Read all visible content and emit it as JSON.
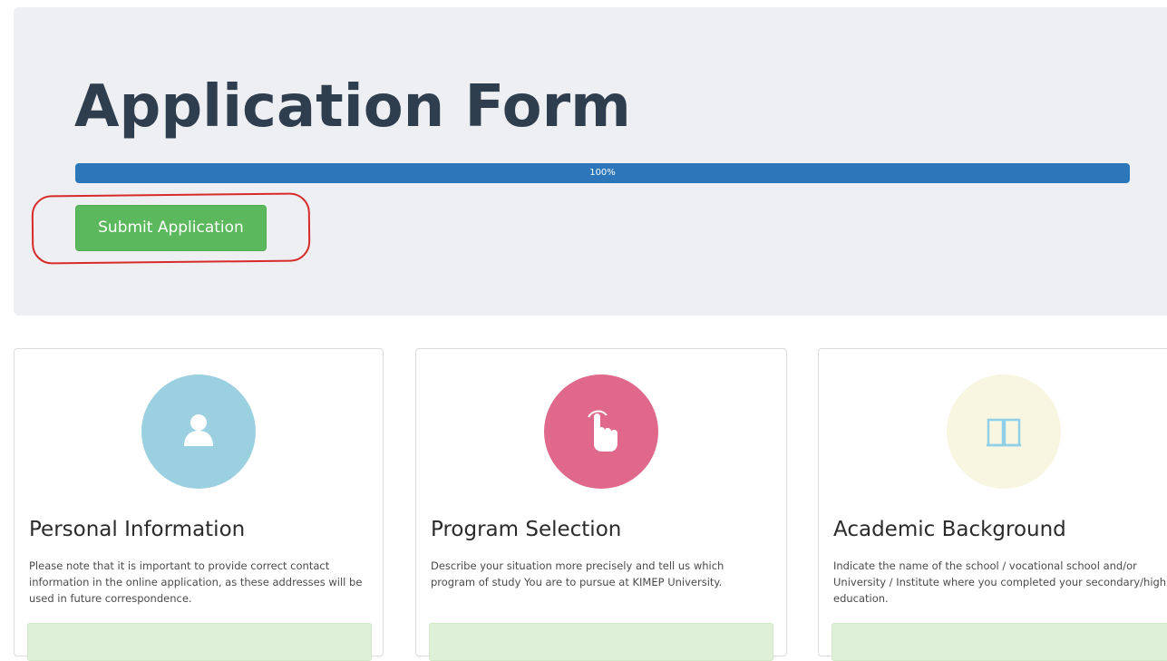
{
  "header": {
    "title": "Application Form"
  },
  "progress": {
    "value": 100,
    "label": "100%",
    "color": "#2b77b9"
  },
  "actions": {
    "submit_label": "Submit Application",
    "submit_color": "#5cb85c",
    "highlight_color": "#d72a2a"
  },
  "cards": [
    {
      "icon": "user-icon",
      "icon_bg": "#9bd0e0",
      "title": "Personal Information",
      "description": "Please note that it is important to provide correct contact information in the online application, as these addresses will be used in future correspondence."
    },
    {
      "icon": "pointer-hand-icon",
      "icon_bg": "#e0688a",
      "title": "Program Selection",
      "description": "Describe your situation more precisely and tell us which program of study You are to pursue at KIMEP University."
    },
    {
      "icon": "book-icon",
      "icon_bg": "#f8f5e1",
      "title": "Academic Background",
      "description": "Indicate the name of the school / vocational school and/or University / Institute where you completed your secondary/high education."
    }
  ]
}
